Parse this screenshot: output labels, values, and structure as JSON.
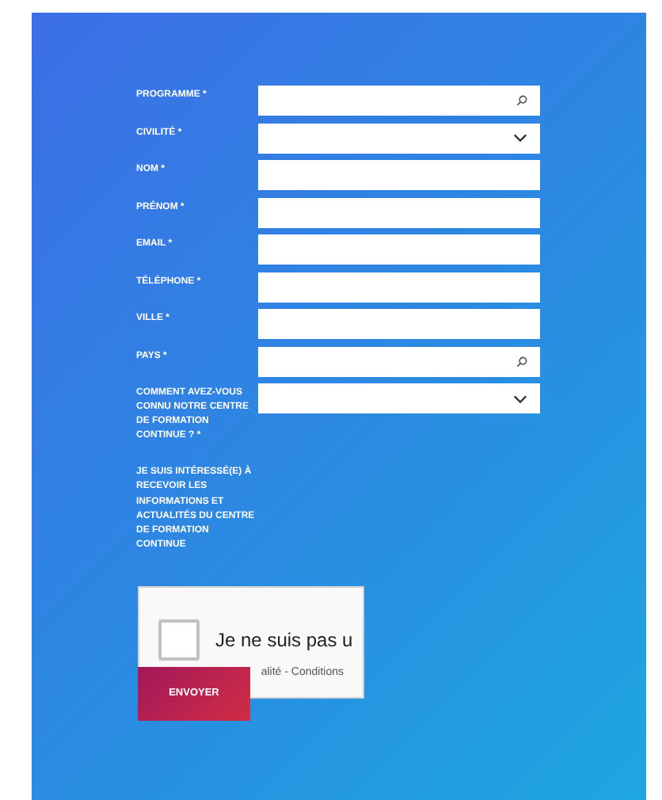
{
  "fields": [
    {
      "label": "PROGRAMME *",
      "kind": "search"
    },
    {
      "label": "CIVILITÉ *",
      "kind": "select"
    },
    {
      "label": "NOM *",
      "kind": "text"
    },
    {
      "label": "PRÉNOM *",
      "kind": "text"
    },
    {
      "label": "EMAIL *",
      "kind": "text"
    },
    {
      "label": "TÉLÉPHONE *",
      "kind": "text"
    },
    {
      "label": "VILLE *",
      "kind": "text"
    },
    {
      "label": "PAYS *",
      "kind": "search"
    },
    {
      "label": "COMMENT AVEZ-VOUS CONNU NOTRE CENTRE DE FORMATION CONTINUE ? *",
      "kind": "select"
    }
  ],
  "consent": {
    "label": "JE SUIS INTÉRESSÉ(E) À RECEVOIR LES INFORMATIONS ET ACTUALITÉS DU CENTRE DE FORMATION CONTINUE"
  },
  "captcha": {
    "text": "Je ne suis pas u",
    "links": "alité - Conditions",
    "checked": false
  },
  "submit": "ENVOYER"
}
